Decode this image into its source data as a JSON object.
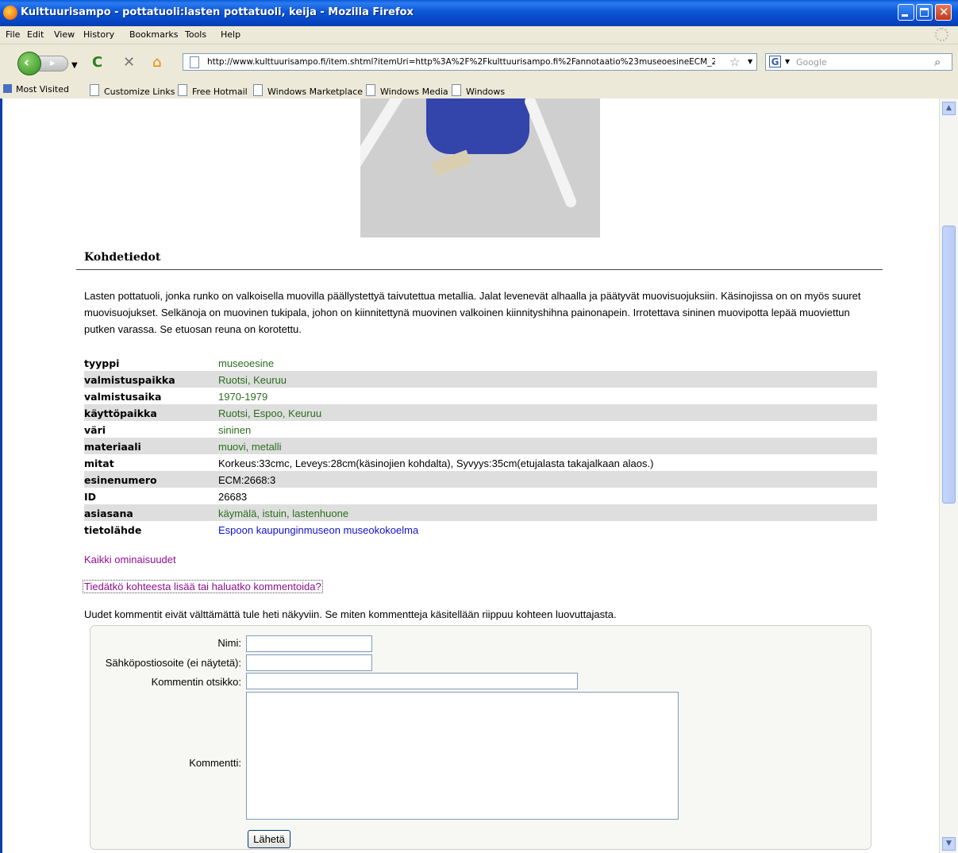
{
  "window": {
    "title": "Kulttuurisampo - pottatuoli:lasten pottatuoli, keija - Mozilla Firefox"
  },
  "menu": [
    "File",
    "Edit",
    "View",
    "History",
    "Bookmarks",
    "Tools",
    "Help"
  ],
  "nav": {
    "url": "http://www.kulttuurisampo.fi/item.shtml?itemUri=http%3A%2F%2Fkulttuurisampo.fi%2Fannotaatio%23museoesineECM_2",
    "search_placeholder": "Google"
  },
  "bookmarks": [
    "Most Visited",
    "Customize Links",
    "Free Hotmail",
    "Windows Marketplace",
    "Windows Media",
    "Windows"
  ],
  "item": {
    "section_title": "Kohdetiedot",
    "description": "Lasten pottatuoli, jonka runko on valkoisella muovilla päällystettyä taivutettua metallia. Jalat levenevät alhaalla ja päätyvät muovisuojuksiin. Käsinojissa on on myös suuret muovisuojukset. Selkänoja on muovinen tukipala, johon on kiinnitettynä muovinen valkoinen kiinnityshihna painonapein. Irrotettava sininen muovipotta lepää muoviettun putken varassa. Se etuosan reuna on korotettu.",
    "properties": [
      {
        "key": "tyyppi",
        "value": "museoesine",
        "style": "link"
      },
      {
        "key": "valmistuspaikka",
        "value": "Ruotsi, Keuruu",
        "style": "link"
      },
      {
        "key": "valmistusaika",
        "value": "1970-1979",
        "style": "link"
      },
      {
        "key": "käyttöpaikka",
        "value": "Ruotsi, Espoo, Keuruu",
        "style": "link"
      },
      {
        "key": "väri",
        "value": "sininen",
        "style": "link"
      },
      {
        "key": "materiaali",
        "value": "muovi, metalli",
        "style": "link"
      },
      {
        "key": "mitat",
        "value": "Korkeus:33cmc, Leveys:28cm(käsinojien kohdalta), Syvyys:35cm(etujalasta takajalkaan alaos.)",
        "style": "text"
      },
      {
        "key": "esinenumero",
        "value": "ECM:2668:3",
        "style": "text"
      },
      {
        "key": "ID",
        "value": "26683",
        "style": "text"
      },
      {
        "key": "asiasana",
        "value": "käymälä, istuin, lastenhuone",
        "style": "link"
      },
      {
        "key": "tietolähde",
        "value": "Espoon kaupunginmuseon museokokoelma",
        "style": "blue"
      }
    ],
    "all_properties_link": "Kaikki ominaisuudet",
    "comment_link": "Tiedätkö kohteesta lisää tai haluatko kommentoida?",
    "notice": "Uudet kommentit eivät välttämättä tule heti näkyviin. Se miten kommentteja käsitellään riippuu kohteen luovuttajasta."
  },
  "form": {
    "name_label": "Nimi:",
    "email_label": "Sähköpostiosoite (ei näytetä):",
    "subject_label": "Kommentin otsikko:",
    "comment_label": "Kommentti:",
    "submit_label": "Lähetä"
  },
  "colors": {
    "link_green": "#2a6e1e",
    "link_blue": "#1212c8",
    "link_visited": "#8e0f8e",
    "row_alt": "#dedede"
  }
}
